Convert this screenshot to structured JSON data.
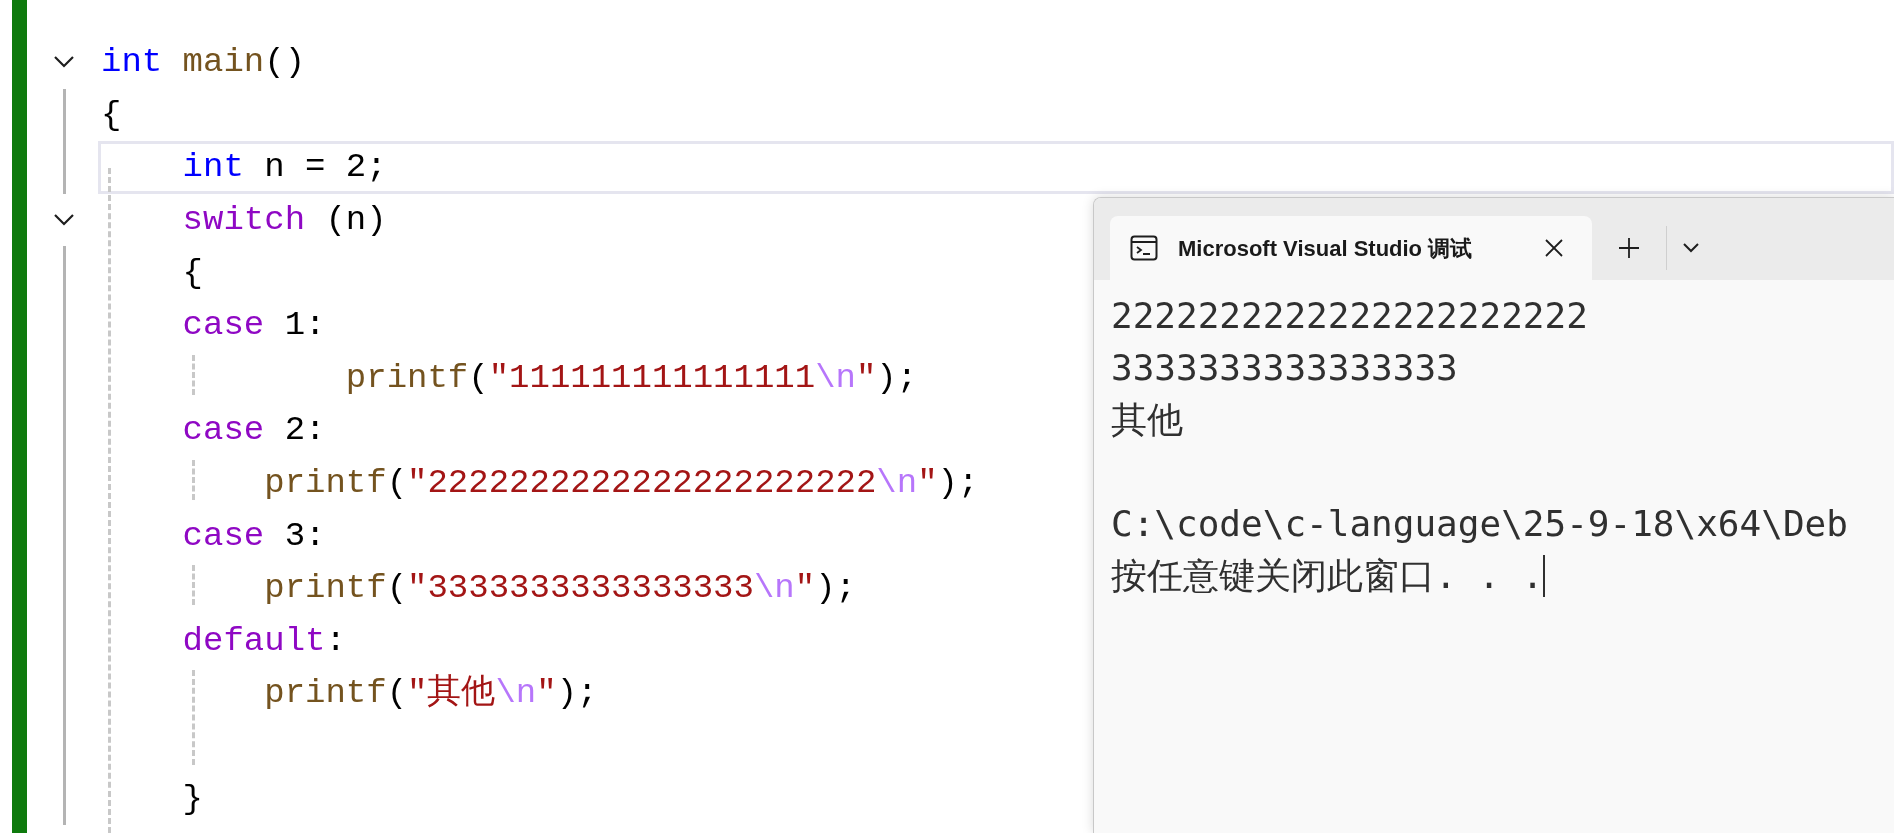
{
  "editor": {
    "lines": [
      {
        "fold": true,
        "tokens": [
          {
            "text": "int",
            "kind": "keyword"
          },
          {
            "text": " main",
            "kind": "function"
          },
          {
            "text": "()",
            "kind": "plain"
          }
        ]
      },
      {
        "fold": false,
        "tokens": [
          {
            "text": "{",
            "kind": "plain"
          }
        ]
      },
      {
        "fold": false,
        "current": true,
        "tokens": [
          {
            "text": "    int",
            "kind": "keyword"
          },
          {
            "text": " n = 2;",
            "kind": "plain"
          }
        ]
      },
      {
        "fold": true,
        "tokens": [
          {
            "text": "    switch",
            "kind": "control"
          },
          {
            "text": " (n)",
            "kind": "plain"
          }
        ]
      },
      {
        "fold": false,
        "tokens": [
          {
            "text": "    {",
            "kind": "plain"
          }
        ]
      },
      {
        "fold": false,
        "tokens": [
          {
            "text": "    case",
            "kind": "control"
          },
          {
            "text": " 1:",
            "kind": "plain"
          }
        ]
      },
      {
        "fold": false,
        "tokens": [
          {
            "text": "            printf",
            "kind": "function"
          },
          {
            "text": "(",
            "kind": "plain"
          },
          {
            "text": "\"111111111111111",
            "kind": "string"
          },
          {
            "text": "\\n",
            "kind": "escape"
          },
          {
            "text": "\"",
            "kind": "string"
          },
          {
            "text": ");",
            "kind": "plain"
          }
        ]
      },
      {
        "fold": false,
        "tokens": [
          {
            "text": "    case",
            "kind": "control"
          },
          {
            "text": " 2:",
            "kind": "plain"
          }
        ]
      },
      {
        "fold": false,
        "tokens": [
          {
            "text": "        printf",
            "kind": "function"
          },
          {
            "text": "(",
            "kind": "plain"
          },
          {
            "text": "\"2222222222222222222222",
            "kind": "string"
          },
          {
            "text": "\\n",
            "kind": "escape"
          },
          {
            "text": "\"",
            "kind": "string"
          },
          {
            "text": ");",
            "kind": "plain"
          }
        ]
      },
      {
        "fold": false,
        "tokens": [
          {
            "text": "    case",
            "kind": "control"
          },
          {
            "text": " 3:",
            "kind": "plain"
          }
        ]
      },
      {
        "fold": false,
        "tokens": [
          {
            "text": "        printf",
            "kind": "function"
          },
          {
            "text": "(",
            "kind": "plain"
          },
          {
            "text": "\"3333333333333333",
            "kind": "string"
          },
          {
            "text": "\\n",
            "kind": "escape"
          },
          {
            "text": "\"",
            "kind": "string"
          },
          {
            "text": ");",
            "kind": "plain"
          }
        ]
      },
      {
        "fold": false,
        "tokens": [
          {
            "text": "    default",
            "kind": "control"
          },
          {
            "text": ":",
            "kind": "plain"
          }
        ]
      },
      {
        "fold": false,
        "tokens": [
          {
            "text": "        printf",
            "kind": "function"
          },
          {
            "text": "(",
            "kind": "plain"
          },
          {
            "text": "\"其他",
            "kind": "string"
          },
          {
            "text": "\\n",
            "kind": "escape"
          },
          {
            "text": "\"",
            "kind": "string"
          },
          {
            "text": ");",
            "kind": "plain"
          }
        ]
      },
      {
        "fold": false
      },
      {
        "fold": false,
        "tokens": [
          {
            "text": "    }",
            "kind": "plain"
          }
        ]
      }
    ]
  },
  "terminal": {
    "tab": {
      "title": "Microsoft Visual Studio 调试",
      "selected": true
    },
    "output": [
      "2222222222222222222222",
      "3333333333333333",
      "其他"
    ],
    "prompt": [
      "C:\\code\\c-language\\25-9-18\\x64\\Deb",
      "按任意键关闭此窗口. . ."
    ]
  }
}
